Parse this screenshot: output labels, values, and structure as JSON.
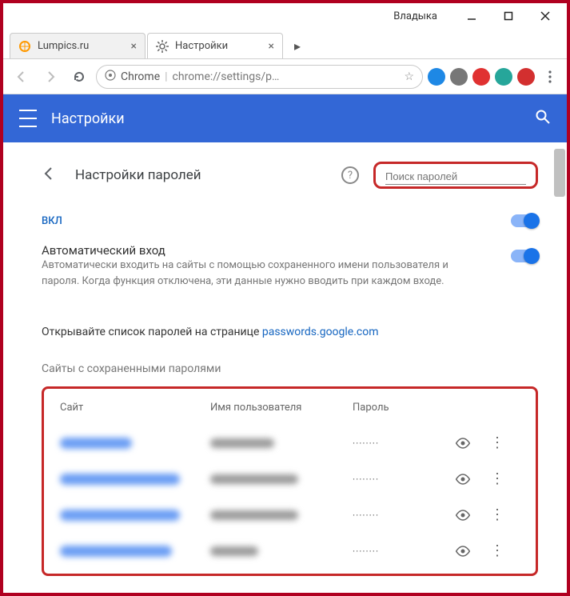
{
  "window": {
    "user_label": "Владыка"
  },
  "tabs": [
    {
      "title": "Lumpics.ru",
      "active": false
    },
    {
      "title": "Настройки",
      "active": true
    }
  ],
  "omnibox": {
    "scheme": "Chrome",
    "url": "chrome://settings/p…"
  },
  "settings_header": {
    "title": "Настройки"
  },
  "passwords_page": {
    "section_title": "Настройки паролей",
    "search_placeholder": "Поиск паролей",
    "toggle_on_label": "ВКЛ",
    "auto_signin_title": "Автоматический вход",
    "auto_signin_desc": "Автоматически входить на сайты с помощью сохраненного имени пользователя и пароля. Когда функция отключена, эти данные нужно вводить при каждом входе.",
    "open_list_prefix": "Открывайте список паролей на странице ",
    "open_list_link": "passwords.google.com",
    "saved_section_title": "Сайты с сохраненными паролями",
    "columns": {
      "site": "Сайт",
      "user": "Имя пользователя",
      "password": "Пароль"
    },
    "rows": [
      {
        "masked_password": "········"
      },
      {
        "masked_password": "········"
      },
      {
        "masked_password": "········"
      },
      {
        "masked_password": "········"
      }
    ]
  }
}
